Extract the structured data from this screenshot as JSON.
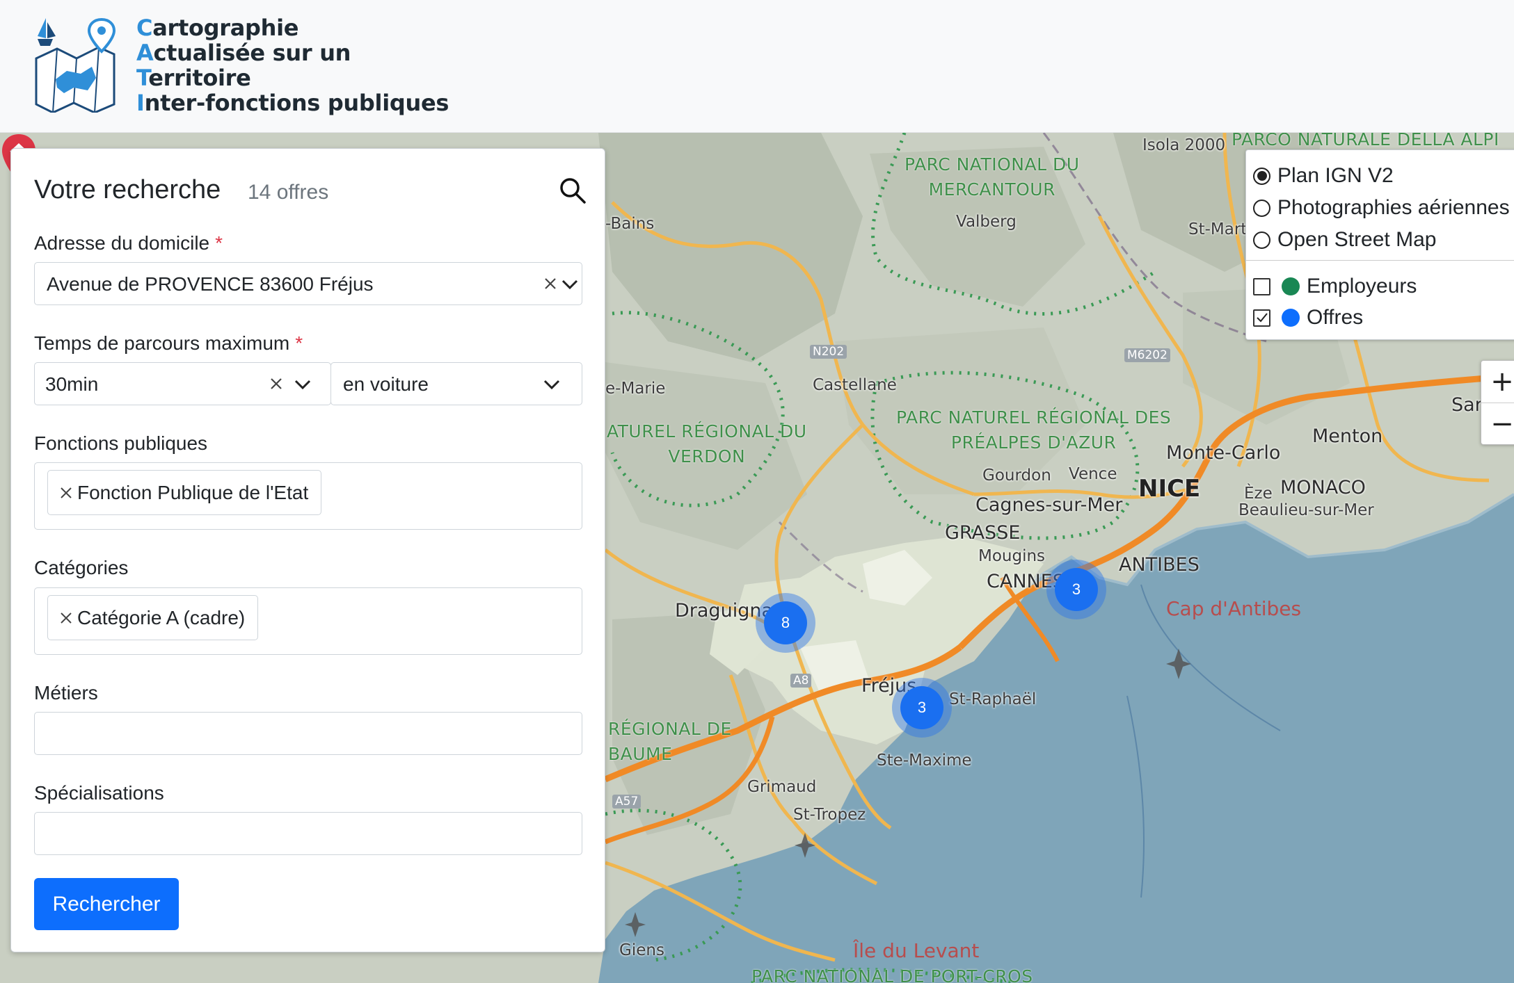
{
  "header": {
    "logo_icon": "map-logo-icon",
    "title_lines": [
      {
        "initial": "C",
        "rest": "artographie"
      },
      {
        "initial": "A",
        "rest": "ctualisée sur un"
      },
      {
        "initial": "T",
        "rest": "erritoire"
      },
      {
        "initial": "I",
        "rest": "nter-fonctions publiques"
      }
    ]
  },
  "search": {
    "title": "Votre recherche",
    "count": "14 offres",
    "search_icon": "search-icon",
    "address": {
      "label": "Adresse du domicile",
      "required": "*",
      "value": "Avenue de PROVENCE 83600 Fréjus"
    },
    "duration": {
      "label": "Temps de parcours maximum",
      "required": "*",
      "value": "30min",
      "mode": "en voiture"
    },
    "fonctions": {
      "label": "Fonctions publiques",
      "tags": [
        "Fonction Publique de l'Etat"
      ]
    },
    "categories": {
      "label": "Catégories",
      "tags": [
        "Catégorie A (cadre)"
      ]
    },
    "metiers": {
      "label": "Métiers",
      "value": ""
    },
    "specialisations": {
      "label": "Spécialisations",
      "value": ""
    },
    "submit": "Rechercher"
  },
  "layers": {
    "base": [
      {
        "label": "Plan IGN V2",
        "selected": true
      },
      {
        "label": "Photographies aériennes",
        "selected": false
      },
      {
        "label": "Open Street Map",
        "selected": false
      }
    ],
    "overlays": [
      {
        "label": "Employeurs",
        "checked": false,
        "color": "#198754"
      },
      {
        "label": "Offres",
        "checked": true,
        "color": "#0d6efd"
      }
    ]
  },
  "zoom": {
    "in": "+",
    "out": "−"
  },
  "map": {
    "clusters": [
      {
        "id": "draguignan",
        "count": "8"
      },
      {
        "id": "cannes",
        "count": "3"
      },
      {
        "id": "frejus",
        "count": "3"
      }
    ],
    "home_marker_icon": "home-icon",
    "labels": {
      "isola": "Isola 2000",
      "parc_alpi": "PARCO NATURALE DELLA ALPI",
      "mercantour": "PARC NATIONAL DU\nMERCANTOUR",
      "valberg": "Valberg",
      "st_mart": "St-Mart",
      "bains": "-Bains",
      "n202": "N202",
      "m6202": "M6202",
      "marie": "e-Marie",
      "castellane": "Castellane",
      "verdon": "ATUREL RÉGIONAL DU\nVERDON",
      "prealpes": "PARC NATUREL RÉGIONAL DES\nPRÉALPES D'AZUR",
      "monte_carlo": "Monte-Carlo",
      "menton": "Menton",
      "sar": "Sar",
      "gourdon": "Gourdon",
      "vence": "Vence",
      "nice": "NICE",
      "eze": "Èze",
      "monaco": "MONACO",
      "beaulieu": "Beaulieu-sur-Mer",
      "cagnes": "Cagnes-sur-Mer",
      "grasse": "GRASSE",
      "antibes": "ANTIBES",
      "mougins": "Mougins",
      "cannes": "CANNES",
      "cap_antibes": "Cap d'Antibes",
      "draguignan": "Draguignan",
      "a8": "A8",
      "frejus": "Fréjus",
      "st_raphael": "St-Raphaël",
      "regional_baume": "RÉGIONAL DE\nBAUME",
      "ste_maxime": "Ste-Maxime",
      "grimaud": "Grimaud",
      "st_tropez": "St-Tropez",
      "a57": "A57",
      "giens": "Giens",
      "levant": "Île du Levant",
      "port_cros": "PARC NATIONAL DE PORT-CROS"
    }
  }
}
